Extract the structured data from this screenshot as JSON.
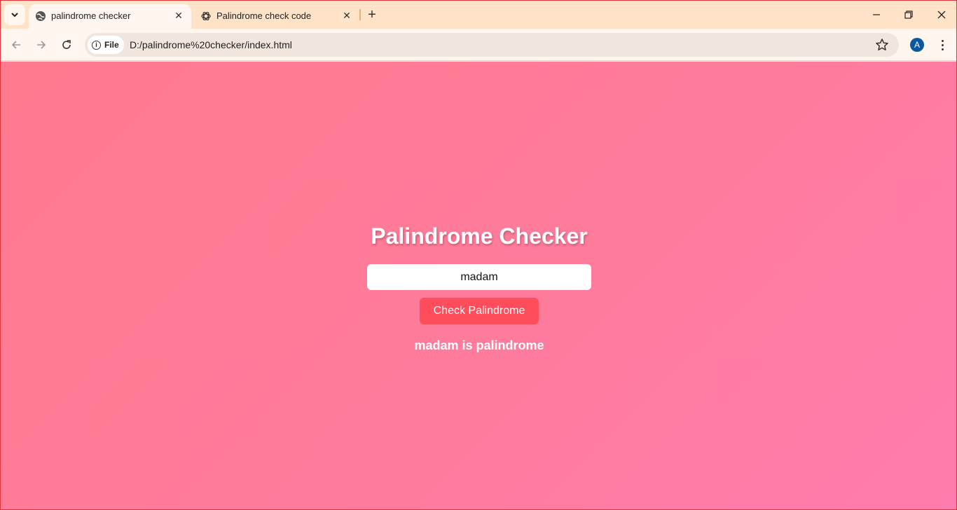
{
  "browser": {
    "tabs": [
      {
        "title": "palindrome checker",
        "favicon": "globe-icon",
        "active": true
      },
      {
        "title": "Palindrome check code",
        "favicon": "openai-icon",
        "active": false
      }
    ],
    "new_tab_label": "+",
    "site_chip_label": "File",
    "url": "D:/palindrome%20checker/index.html",
    "profile_initial": "A",
    "colors": {
      "tabstrip": "#ffe3c8",
      "toolbar": "#fff6f0",
      "profile": "#0b57a0"
    }
  },
  "page": {
    "title": "Palindrome Checker",
    "input_value": "madam",
    "button_label": "Check Palindrome",
    "result": "madam is palindrome",
    "colors": {
      "background_start": "#ff7a8e",
      "background_end": "#ff7cae",
      "button": "#ff4d5c",
      "text": "#ffffff"
    }
  }
}
